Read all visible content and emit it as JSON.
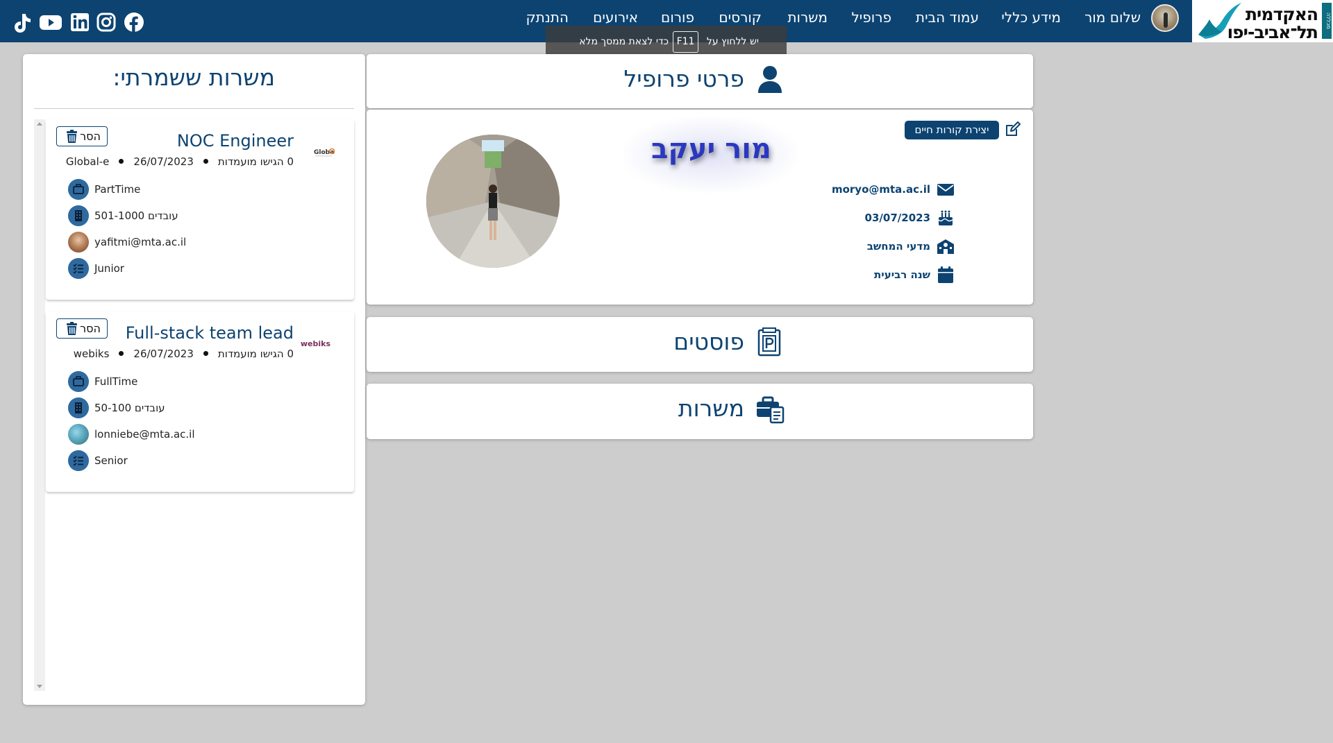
{
  "colors": {
    "navy": "#0d4371",
    "accent_name": "#2a38c0",
    "page_bg": "#cdcdcd",
    "icon_circle": "#2e6a9f"
  },
  "logo": {
    "line1": "האקדמית",
    "line2": "תל־אביב-יפו",
    "strip": "מכללה"
  },
  "nav": {
    "greeting": "שלום מור",
    "items": [
      "מידע כללי",
      "עמוד הבית",
      "פרופיל",
      "משרות",
      "קורסים",
      "פורום",
      "אירועים",
      "התנתק"
    ]
  },
  "social_icons": [
    "tiktok-icon",
    "youtube-icon",
    "linkedin-icon",
    "instagram-icon",
    "facebook-icon"
  ],
  "fullscreen_toast": {
    "part1": "יש ללחוץ על",
    "key": "F11",
    "part2": "כדי לצאת ממסך מלא"
  },
  "saved_jobs": {
    "title": "משרות ששמרתי:",
    "remove_label": "הסר",
    "items": [
      {
        "title": "NOC Engineer",
        "company_logo": "Global-e",
        "meta": {
          "applicants": "0 הגישו מועמדות",
          "date": "26/07/2023",
          "company": "Global-e"
        },
        "job_type": "PartTime",
        "size": "501-1000 עובדים",
        "contact": "yafitmi@mta.ac.il",
        "level": "Junior"
      },
      {
        "title": "Full-stack team lead",
        "company_logo": "webiks",
        "meta": {
          "applicants": "0 הגישו מועמדות",
          "date": "26/07/2023",
          "company": "webiks"
        },
        "job_type": "FullTime",
        "size": "50-100 עובדים",
        "contact": "lonniebe@mta.ac.il",
        "level": "Senior"
      }
    ]
  },
  "profile": {
    "header": "פרטי פרופיל",
    "cv_button": "יצירת קורות חיים",
    "name": "מור יעקב",
    "email": "moryo@mta.ac.il",
    "birthday": "03/07/2023",
    "department": "מדעי המחשב",
    "year": "שנה רביעית"
  },
  "sections": {
    "posts": "פוסטים",
    "jobs": "משרות"
  }
}
